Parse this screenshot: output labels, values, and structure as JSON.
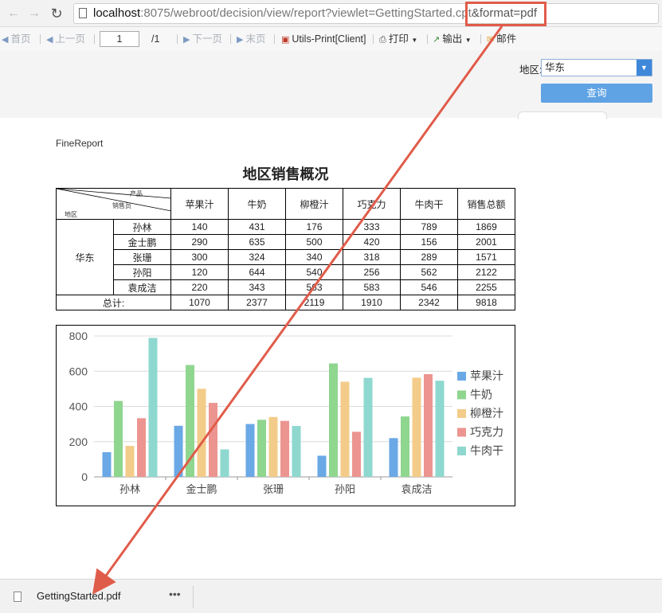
{
  "browser": {
    "back_icon": "arrow-left-icon",
    "forward_icon": "arrow-right-icon",
    "reload_icon": "reload-icon",
    "url_host": "localhost",
    "url_rest": ":8075/webroot/decision/view/report?viewlet=GettingStarted.cpt",
    "url_param": "&format=pdf",
    "highlight_color": "#e05c4a"
  },
  "toolbar": {
    "first": "首页",
    "prev": "上一页",
    "page": "1",
    "total": "/1",
    "next": "下一页",
    "last": "末页",
    "utils_print": "Utils-Print[Client]",
    "print": "打印",
    "export": "输出",
    "mail": "邮件"
  },
  "params": {
    "region_label": "地区:",
    "region_value": "华东",
    "query_button": "查询"
  },
  "report": {
    "brand": "FineReport",
    "title": "地区销售概况",
    "diag_product": "产品",
    "diag_seller": "销售员",
    "diag_region": "地区",
    "columns": [
      "苹果汁",
      "牛奶",
      "柳橙汁",
      "巧克力",
      "牛肉干",
      "销售总额"
    ],
    "region": "华东",
    "rows": [
      {
        "name": "孙林",
        "values": [
          "140",
          "431",
          "176",
          "333",
          "789",
          "1869"
        ]
      },
      {
        "name": "金士鹏",
        "values": [
          "290",
          "635",
          "500",
          "420",
          "156",
          "2001"
        ]
      },
      {
        "name": "张珊",
        "values": [
          "300",
          "324",
          "340",
          "318",
          "289",
          "1571"
        ]
      },
      {
        "name": "孙阳",
        "values": [
          "120",
          "644",
          "540",
          "256",
          "562",
          "2122"
        ]
      },
      {
        "name": "袁成洁",
        "values": [
          "220",
          "343",
          "563",
          "583",
          "546",
          "2255"
        ]
      }
    ],
    "total_label": "总计:",
    "totals": [
      "1070",
      "2377",
      "2119",
      "1910",
      "2342",
      "9818"
    ]
  },
  "chart_data": {
    "type": "bar",
    "categories": [
      "孙林",
      "金士鹏",
      "张珊",
      "孙阳",
      "袁成洁"
    ],
    "series": [
      {
        "name": "苹果汁",
        "color": "#6aa8e6",
        "values": [
          140,
          290,
          300,
          120,
          220
        ]
      },
      {
        "name": "牛奶",
        "color": "#8fd68f",
        "values": [
          431,
          635,
          324,
          644,
          343
        ]
      },
      {
        "name": "柳橙汁",
        "color": "#f3cc8a",
        "values": [
          176,
          500,
          340,
          540,
          563
        ]
      },
      {
        "name": "巧克力",
        "color": "#ec9590",
        "values": [
          333,
          420,
          318,
          256,
          583
        ]
      },
      {
        "name": "牛肉干",
        "color": "#8ed8cf",
        "values": [
          789,
          156,
          289,
          562,
          546
        ]
      }
    ],
    "ylim": [
      0,
      800
    ],
    "yticks": [
      "0",
      "200",
      "400",
      "600",
      "800"
    ],
    "grid": true,
    "legend": "right"
  },
  "download": {
    "file_name": "GettingStarted.pdf",
    "more": "•••",
    "file_icon": "pdf-file-icon"
  }
}
